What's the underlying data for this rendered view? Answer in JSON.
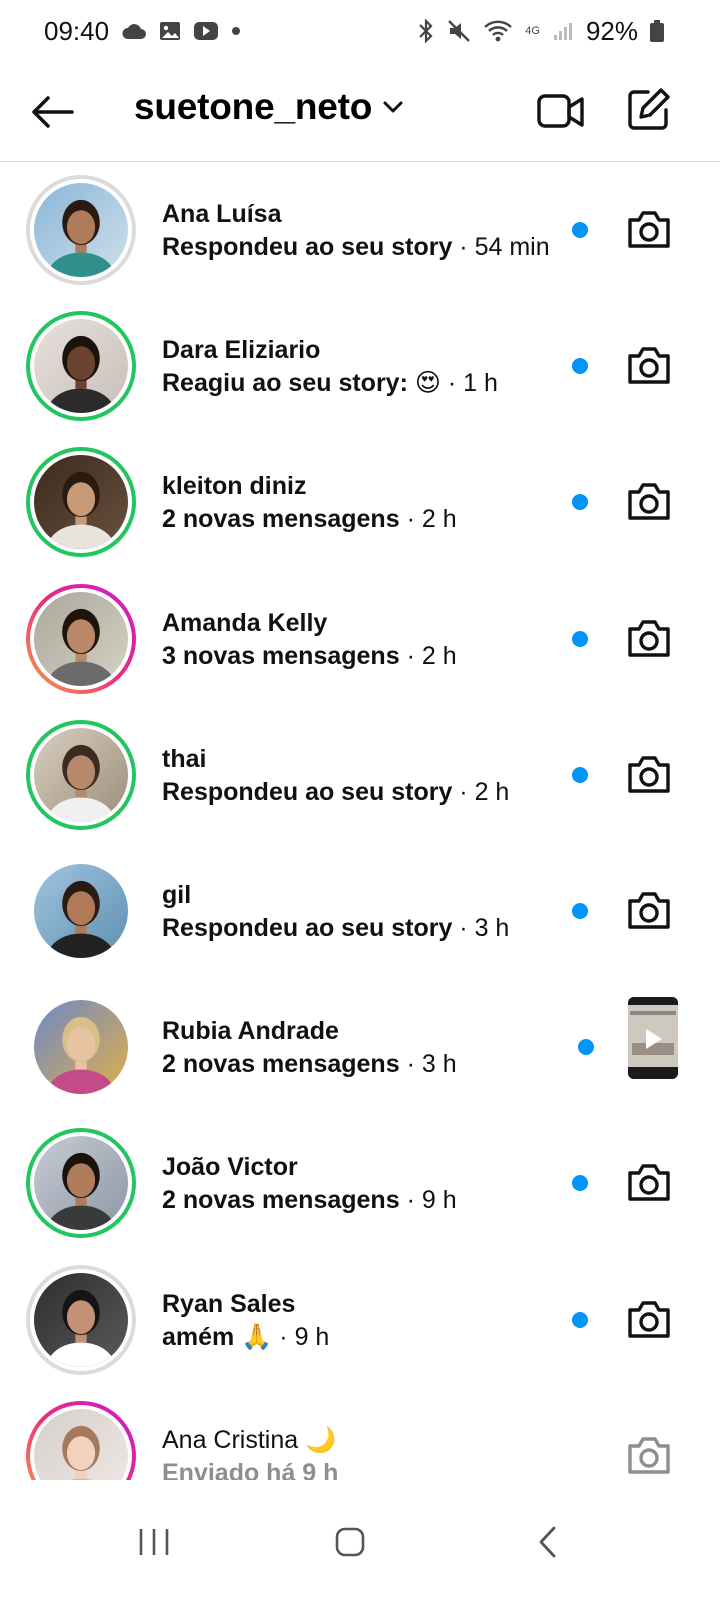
{
  "status_bar": {
    "time": "09:40",
    "battery": "92%",
    "network": "4G"
  },
  "header": {
    "username": "suetone_neto"
  },
  "colors": {
    "unread": "#0095f6",
    "story_ring_green": "#22c55e",
    "muted_text": "#8e8e8e"
  },
  "conversations": [
    {
      "name": "Ana Luísa",
      "message": "Respondeu ao seu story",
      "time": "54 min",
      "ring": "seen",
      "unread": true,
      "action": "camera-icon"
    },
    {
      "name": "Dara Eliziario",
      "message": "Reagiu ao seu story: 😍",
      "time": "1 h",
      "ring": "green",
      "unread": true,
      "action": "camera-icon"
    },
    {
      "name": "kleiton diniz",
      "message": "2 novas mensagens",
      "time": "2 h",
      "ring": "green",
      "unread": true,
      "action": "camera-icon"
    },
    {
      "name": "Amanda Kelly",
      "message": "3 novas mensagens",
      "time": "2 h",
      "ring": "story",
      "unread": true,
      "action": "camera-icon"
    },
    {
      "name": "thai",
      "message": "Respondeu ao seu story",
      "time": "2 h",
      "ring": "green",
      "unread": true,
      "action": "camera-icon"
    },
    {
      "name": "gil",
      "message": "Respondeu ao seu story",
      "time": "3 h",
      "ring": "none",
      "unread": true,
      "action": "camera-icon"
    },
    {
      "name": "Rubia Andrade",
      "message": "2 novas mensagens",
      "time": "3 h",
      "ring": "none",
      "unread": true,
      "action": "video-thumbnail"
    },
    {
      "name": "João Victor",
      "message": "2 novas mensagens",
      "time": "9 h",
      "ring": "green",
      "unread": true,
      "action": "camera-icon"
    },
    {
      "name": "Ryan Sales",
      "message": "amém 🙏",
      "time": "9 h",
      "ring": "seen",
      "unread": true,
      "action": "camera-icon"
    },
    {
      "name": "Ana Cristina 🌙",
      "message": "Enviado há 9 h",
      "time": "",
      "ring": "story",
      "unread": false,
      "action": "camera-icon"
    }
  ]
}
